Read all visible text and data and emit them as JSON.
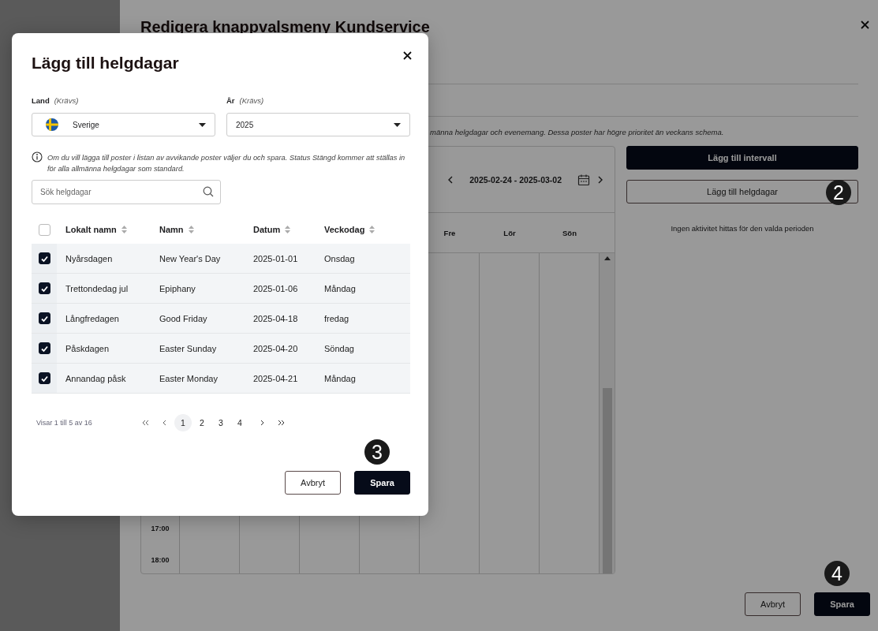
{
  "page": {
    "title": "Redigera knappvalsmeny Kundservice",
    "notice": "männa helgdagar och evenemang. Dessa poster har högre prioritet än veckans schema.",
    "calendar": {
      "range": "2025-02-24 - 2025-03-02",
      "days": [
        "Fre",
        "Lör",
        "Sön"
      ],
      "times": [
        "17:00",
        "18:00"
      ]
    },
    "actions": [
      {
        "label": "Lägg till intervall",
        "kind": "primary"
      },
      {
        "label": "Lägg till helgdagar",
        "kind": "secondary",
        "marker": "2"
      }
    ],
    "empty_message": "Ingen aktivitet hittas för den valda perioden",
    "footer_buttons": [
      {
        "label": "Avbryt",
        "kind": "secondary"
      },
      {
        "label": "Spara",
        "kind": "primary",
        "marker": "4"
      }
    ]
  },
  "dialog": {
    "title": "Lägg till helgdagar",
    "fields": [
      {
        "label": "Land",
        "hint": "(Krävs)",
        "value": "Sverige",
        "kind": "country"
      },
      {
        "label": "År",
        "hint": "(Krävs)",
        "value": "2025",
        "kind": "plain"
      }
    ],
    "info": "Om du vill lägga till poster i listan av avvikande poster väljer du och spara. Status Stängd kommer att ställas in för alla allmänna helgdagar som standard.",
    "search": {
      "placeholder": "Sök helgdagar"
    },
    "select_all": {
      "checked": false
    },
    "columns": [
      "Lokalt namn",
      "Namn",
      "Datum",
      "Veckodag"
    ],
    "rows": [
      {
        "local_name": "Nyårsdagen",
        "name": "New Year's Day",
        "date": "2025-01-01",
        "weekday": "Onsdag",
        "checked": true
      },
      {
        "local_name": "Trettondedag jul",
        "name": "Epiphany",
        "date": "2025-01-06",
        "weekday": "Måndag",
        "checked": true
      },
      {
        "local_name": "Långfredagen",
        "name": "Good Friday",
        "date": "2025-04-18",
        "weekday": "fredag",
        "checked": true
      },
      {
        "local_name": "Påskdagen",
        "name": "Easter Sunday",
        "date": "2025-04-20",
        "weekday": "Söndag",
        "checked": true
      },
      {
        "local_name": "Annandag påsk",
        "name": "Easter Monday",
        "date": "2025-04-21",
        "weekday": "Måndag",
        "checked": true
      }
    ],
    "range_text": "Visar 1 till 5 av 16",
    "pages": [
      {
        "label": "1",
        "selected": true
      },
      {
        "label": "2",
        "selected": false
      },
      {
        "label": "3",
        "selected": false
      },
      {
        "label": "4",
        "selected": false
      }
    ],
    "buttons": [
      {
        "label": "Avbryt",
        "kind": "secondary"
      },
      {
        "label": "Spara",
        "kind": "primary",
        "marker": "3"
      }
    ]
  }
}
